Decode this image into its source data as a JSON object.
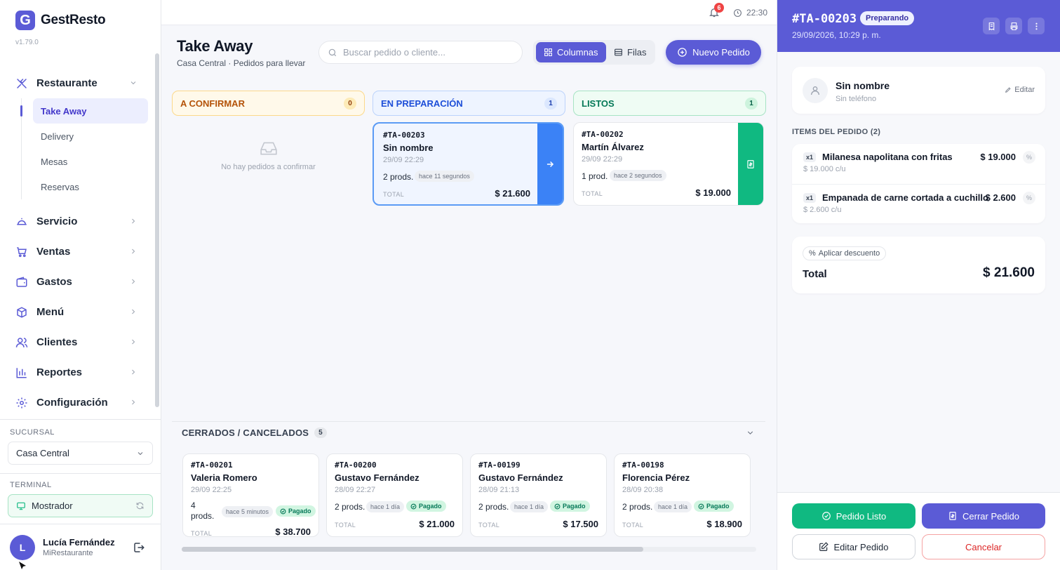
{
  "brand": {
    "logo_letter": "G",
    "name": "GestResto",
    "version": "v1.79.0"
  },
  "nav": {
    "restaurante": "Restaurante",
    "sub": [
      "Take Away",
      "Delivery",
      "Mesas",
      "Reservas"
    ],
    "items": [
      "Servicio",
      "Ventas",
      "Gastos",
      "Menú",
      "Clientes",
      "Reportes",
      "Configuración"
    ]
  },
  "sucursal": {
    "label": "SUCURSAL",
    "value": "Casa Central"
  },
  "terminal": {
    "label": "TERMINAL",
    "value": "Mostrador"
  },
  "user": {
    "initial": "L",
    "name": "Lucía Fernández",
    "org": "MiRestaurante"
  },
  "topbar": {
    "notifications": "6",
    "time": "22:30"
  },
  "header": {
    "title": "Take Away",
    "subtitle": "Casa Central · Pedidos para llevar",
    "search_placeholder": "Buscar pedido o cliente...",
    "view_columns": "Columnas",
    "view_rows": "Filas",
    "new_order": "Nuevo Pedido"
  },
  "columns": {
    "confirm": {
      "title": "A CONFIRMAR",
      "count": "0",
      "empty": "No hay pedidos a confirmar"
    },
    "prep": {
      "title": "EN PREPARACIÓN",
      "count": "1"
    },
    "ready": {
      "title": "LISTOS",
      "count": "1"
    }
  },
  "prep_order": {
    "id": "#TA-00203",
    "name": "Sin nombre",
    "date": "29/09 22:29",
    "prods": "2 prods.",
    "time": "hace 11 segundos",
    "total_label": "TOTAL",
    "total": "$ 21.600"
  },
  "ready_order": {
    "id": "#TA-00202",
    "name": "Martín Álvarez",
    "date": "29/09 22:29",
    "prods": "1 prod.",
    "time": "hace 2 segundos",
    "total_label": "TOTAL",
    "total": "$ 19.000"
  },
  "closed": {
    "title": "CERRADOS / CANCELADOS",
    "count": "5",
    "paid_label": "Pagado",
    "total_label": "TOTAL",
    "orders": [
      {
        "id": "#TA-00201",
        "name": "Valeria Romero",
        "date": "29/09 22:25",
        "prods": "4 prods.",
        "time": "hace 5 minutos",
        "total": "$ 38.700"
      },
      {
        "id": "#TA-00200",
        "name": "Gustavo Fernández",
        "date": "28/09 22:27",
        "prods": "2 prods.",
        "time": "hace 1 día",
        "total": "$ 21.000"
      },
      {
        "id": "#TA-00199",
        "name": "Gustavo Fernández",
        "date": "28/09 21:13",
        "prods": "2 prods.",
        "time": "hace 1 día",
        "total": "$ 17.500"
      },
      {
        "id": "#TA-00198",
        "name": "Florencia Pérez",
        "date": "28/09 20:38",
        "prods": "2 prods.",
        "time": "hace 1 día",
        "total": "$ 18.900"
      }
    ]
  },
  "panel": {
    "id": "#TA-00203",
    "status": "Preparando",
    "datetime": "29/09/2026, 10:29 p. m.",
    "customer_name": "Sin nombre",
    "customer_phone": "Sin teléfono",
    "edit_label": "Editar",
    "items_title": "ITEMS DEL PEDIDO (2)",
    "items": [
      {
        "qty": "x1",
        "name": "Milanesa napolitana con fritas",
        "unit": "$ 19.000 c/u",
        "price": "$ 19.000"
      },
      {
        "qty": "x1",
        "name": "Empanada de carne cortada a cuchillo",
        "unit": "$ 2.600 c/u",
        "price": "$ 2.600"
      }
    ],
    "discount_label": "Aplicar descuento",
    "total_label": "Total",
    "total": "$ 21.600",
    "btn_ready": "Pedido Listo",
    "btn_close": "Cerrar Pedido",
    "btn_edit": "Editar Pedido",
    "btn_cancel": "Cancelar"
  },
  "colors": {
    "accent": "#5b5bd6",
    "success": "#10b981",
    "info": "#3b82f6",
    "warning": "#b45309",
    "danger": "#dc2626"
  }
}
